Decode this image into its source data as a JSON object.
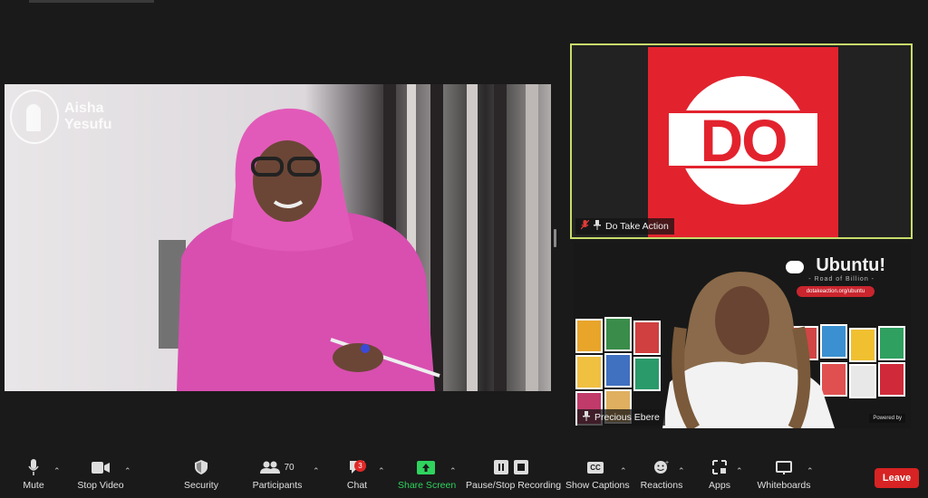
{
  "main_video": {
    "watermark": [
      "Aisha",
      "Yesufu"
    ]
  },
  "tiles": [
    {
      "id": "do-take-action",
      "logo_text": "DO",
      "label": "Do Take Action",
      "muted": true,
      "pinned": true
    },
    {
      "id": "precious-ebere",
      "label": "Precious Ebere",
      "pinned": true,
      "background": {
        "brand": "Ubuntu!",
        "sub": "- Road of Billion -",
        "url": "dotakeaction.org/ubuntu",
        "footer": "Powered by"
      }
    }
  ],
  "toolbar": {
    "items": [
      {
        "key": "mute",
        "label": "Mute",
        "icon": "microphone-icon",
        "caret": true
      },
      {
        "key": "video",
        "label": "Stop Video",
        "icon": "video-camera-icon",
        "caret": true
      },
      {
        "key": "security",
        "label": "Security",
        "icon": "shield-icon",
        "caret": false
      },
      {
        "key": "participants",
        "label": "Participants",
        "icon": "participants-icon",
        "count": "70",
        "caret": true
      },
      {
        "key": "chat",
        "label": "Chat",
        "icon": "chat-icon",
        "badge": "3",
        "caret": true
      },
      {
        "key": "share",
        "label": "Share Screen",
        "icon": "share-screen-icon",
        "caret": true
      },
      {
        "key": "record",
        "label": "Pause/Stop Recording",
        "icon": "pause-stop-icon",
        "caret": false
      },
      {
        "key": "captions",
        "label": "Show Captions",
        "icon": "cc-icon",
        "icon_text": "CC",
        "caret": true
      },
      {
        "key": "reactions",
        "label": "Reactions",
        "icon": "emoji-icon",
        "caret": true
      },
      {
        "key": "apps",
        "label": "Apps",
        "icon": "apps-icon",
        "caret": true
      },
      {
        "key": "whiteboards",
        "label": "Whiteboards",
        "icon": "whiteboard-icon",
        "caret": true
      }
    ],
    "leave_label": "Leave"
  },
  "colors": {
    "accent_green": "#2fd35e",
    "leave_red": "#d72323",
    "speaker_border": "#c8dd6a",
    "do_red": "#e2232e"
  }
}
